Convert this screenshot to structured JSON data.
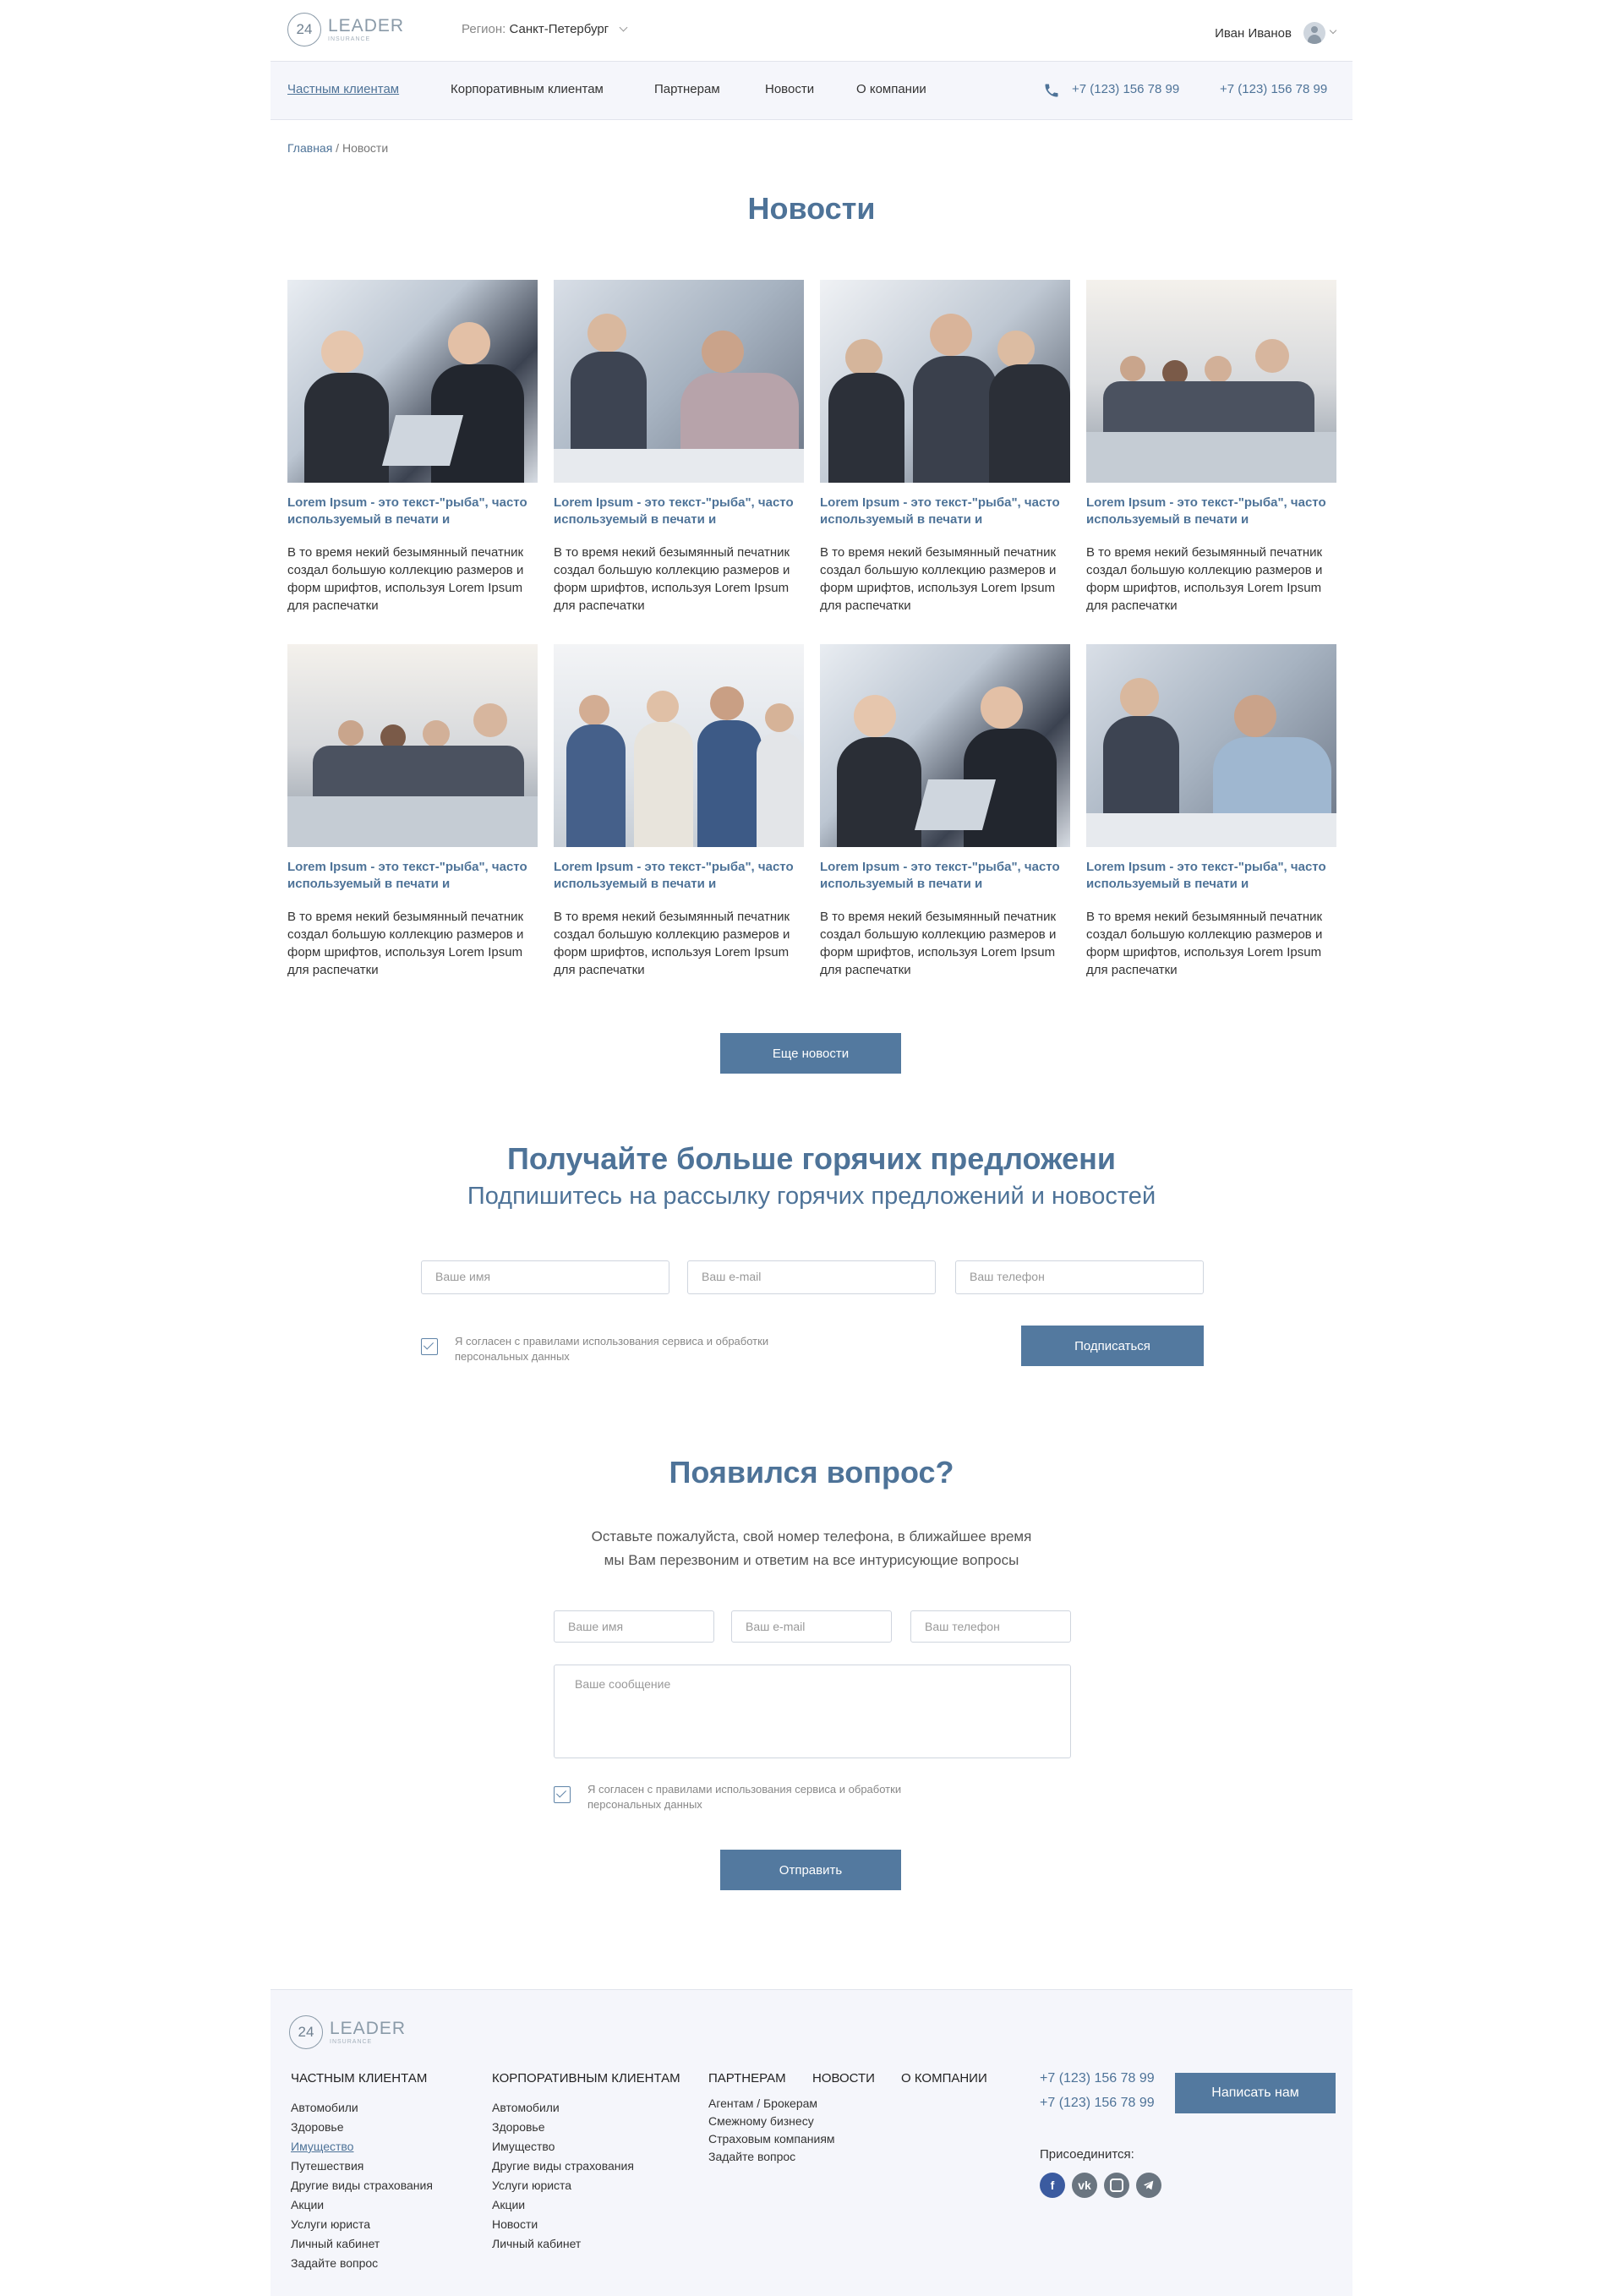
{
  "header": {
    "logo_number": "24",
    "logo_word": "LEADER",
    "logo_sub": "INSURANCE",
    "region_label": "Регион:",
    "region_value": "Санкт-Петербург",
    "user_name": "Иван Иванов"
  },
  "nav": {
    "items": [
      "Частным клиентам",
      "Корпоративным клиентам",
      "Партнерам",
      "Новости",
      "О компании"
    ],
    "phone1": "+7 (123) 156 78 99",
    "phone2": "+7 (123) 156 78 99"
  },
  "breadcrumb": {
    "home": "Главная",
    "separator": " / ",
    "current": "Новости"
  },
  "page_title": "Новости",
  "news": [
    {
      "title": "Lorem Ipsum - это текст-\"рыба\", часто используемый в печати и",
      "text": "В то время некий безымянный печатник создал большую коллекцию размеров и форм шрифтов, используя Lorem Ipsum для распечатки"
    },
    {
      "title": "Lorem Ipsum - это текст-\"рыба\", часто используемый в печати и",
      "text": "В то время некий безымянный печатник создал большую коллекцию размеров и форм шрифтов, используя Lorem Ipsum для распечатки"
    },
    {
      "title": "Lorem Ipsum - это текст-\"рыба\", часто используемый в печати и",
      "text": "В то время некий безымянный печатник создал большую коллекцию размеров и форм шрифтов, используя Lorem Ipsum для распечатки"
    },
    {
      "title": "Lorem Ipsum - это текст-\"рыба\", часто используемый в печати и",
      "text": "В то время некий безымянный печатник создал большую коллекцию размеров и форм шрифтов, используя Lorem Ipsum для распечатки"
    },
    {
      "title": "Lorem Ipsum - это текст-\"рыба\", часто используемый в печати и",
      "text": "В то время некий безымянный печатник создал большую коллекцию размеров и форм шрифтов, используя Lorem Ipsum для распечатки"
    },
    {
      "title": "Lorem Ipsum - это текст-\"рыба\", часто используемый в печати и",
      "text": "В то время некий безымянный печатник создал большую коллекцию размеров и форм шрифтов, используя Lorem Ipsum для распечатки"
    },
    {
      "title": "Lorem Ipsum - это текст-\"рыба\", часто используемый в печати и",
      "text": "В то время некий безымянный печатник создал большую коллекцию размеров и форм шрифтов, используя Lorem Ipsum для распечатки"
    },
    {
      "title": "Lorem Ipsum - это текст-\"рыба\", часто используемый в печати и",
      "text": "В то время некий безымянный печатник создал большую коллекцию размеров и форм шрифтов, используя Lorem Ipsum для распечатки"
    }
  ],
  "more_news_label": "Еще новости",
  "subscribe": {
    "title": "Получайте больше горячих предложени",
    "subtitle": "Подпишитесь на рассылку горячих предложений и новостей",
    "name_placeholder": "Ваше имя",
    "email_placeholder": "Ваш e-mail",
    "phone_placeholder": "Ваш телефон",
    "consent_line1": "Я согласен с правилами использования сервиса и обработки",
    "consent_line2": "персональных данных",
    "button": "Подписаться"
  },
  "question": {
    "title": "Появился вопрос?",
    "text_line1": "Оставьте пожалуйста, свой номер телефона, в ближайшее время",
    "text_line2": "мы Вам перезвоним и ответим на все интурисующие вопросы",
    "name_placeholder": "Ваше имя",
    "email_placeholder": "Ваш e-mail",
    "phone_placeholder": "Ваш телефон",
    "message_placeholder": "Ваше сообщение",
    "consent_line1": "Я согласен с правилами использования сервиса и обработки",
    "consent_line2": "персональных данных",
    "button": "Отправить"
  },
  "footer": {
    "col1": {
      "heading": "ЧАСТНЫМ КЛИЕНТАМ",
      "items": [
        "Автомобили",
        "Здоровье",
        "Имущество",
        "Путешествия",
        "Другие виды страхования",
        "Акции",
        "Услуги юриста",
        "Личный кабинет",
        "Задайте вопрос"
      ]
    },
    "col2": {
      "heading": "КОРПОРАТИВНЫМ КЛИЕНТАМ",
      "items": [
        "Автомобили",
        "Здоровье",
        "Имущество",
        "Другие виды страхования",
        "Услуги юриста",
        "Акции",
        "Новости",
        "Личный кабинет"
      ]
    },
    "col3": {
      "heading": "ПАРТНЕРАМ",
      "items": [
        "Агентам / Брокерам",
        "Смежному бизнесу",
        "Страховым компаниям",
        "Задайте вопрос"
      ]
    },
    "col4": {
      "heading": "НОВОСТИ"
    },
    "col5": {
      "heading": "О КОМПАНИИ"
    },
    "phone1": "+7 (123) 156 78 99",
    "phone2": "+7 (123) 156 78 99",
    "join_label": "Присоединится:",
    "write_button": "Написать нам",
    "social": [
      "facebook-icon",
      "vk-icon",
      "instagram-icon",
      "telegram-icon"
    ]
  },
  "colors": {
    "accent": "#4e7398",
    "button": "#53799f",
    "nav_bg": "#f5f6fb"
  }
}
